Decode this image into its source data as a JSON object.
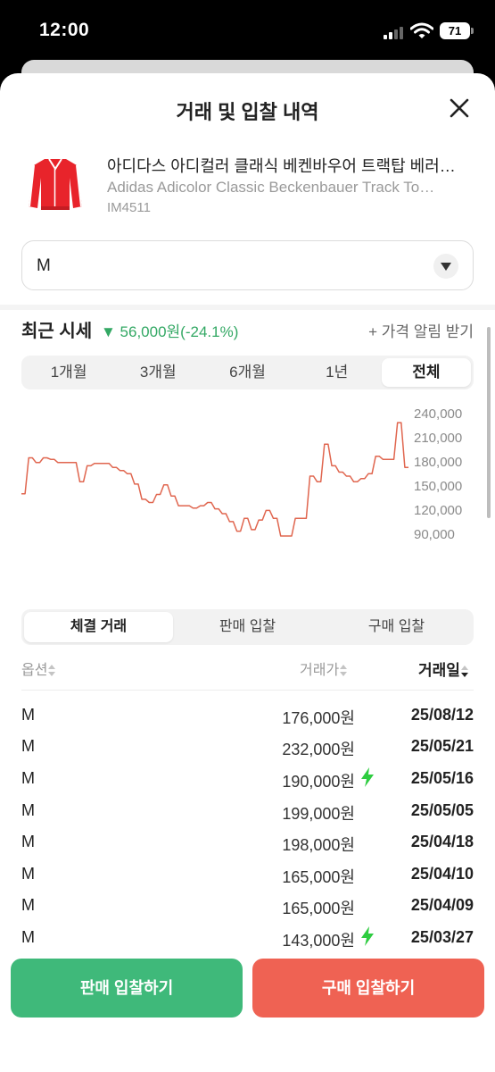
{
  "status_bar": {
    "time": "12:00",
    "battery": "71"
  },
  "sheet": {
    "title": "거래 및 입찰 내역"
  },
  "product": {
    "name_ko": "아디다스 아디컬러 클래식 베켄바우어 트랙탑 베러…",
    "name_en": "Adidas Adicolor Classic Beckenbauer Track To…",
    "code": "IM4511",
    "image": "red-track-jacket-icon"
  },
  "size_selector": {
    "value": "M"
  },
  "price_section": {
    "title": "최근 시세",
    "change": "▼ 56,000원(-24.1%)",
    "alert": "+ 가격 알림 받기"
  },
  "period_tabs": [
    {
      "label": "1개월",
      "active": false
    },
    {
      "label": "3개월",
      "active": false
    },
    {
      "label": "6개월",
      "active": false
    },
    {
      "label": "1년",
      "active": false
    },
    {
      "label": "전체",
      "active": true
    }
  ],
  "chart_data": {
    "type": "line",
    "line_color": "#e0664f",
    "y_ticks": [
      "240,000",
      "210,000",
      "180,000",
      "150,000",
      "120,000",
      "90,000"
    ],
    "ylim": [
      90000,
      240000
    ],
    "y": [
      143000,
      143000,
      188000,
      188000,
      182000,
      182000,
      188000,
      188000,
      186000,
      186000,
      182000,
      182000,
      182000,
      182000,
      182000,
      182000,
      158000,
      158000,
      178000,
      178000,
      181000,
      181000,
      181000,
      181000,
      181000,
      176000,
      176000,
      172000,
      172000,
      168000,
      168000,
      155000,
      155000,
      136000,
      136000,
      132000,
      132000,
      142000,
      142000,
      154000,
      154000,
      140000,
      140000,
      128000,
      128000,
      128000,
      128000,
      125000,
      125000,
      128000,
      128000,
      132000,
      132000,
      124000,
      124000,
      118000,
      118000,
      108000,
      108000,
      96000,
      96000,
      112000,
      112000,
      98000,
      98000,
      110000,
      110000,
      122000,
      122000,
      112000,
      112000,
      90000,
      90000,
      90000,
      90000,
      112000,
      112000,
      112000,
      112000,
      165000,
      165000,
      158000,
      158000,
      205000,
      205000,
      178000,
      178000,
      170000,
      170000,
      165000,
      165000,
      158000,
      158000,
      162000,
      162000,
      168000,
      168000,
      190000,
      190000,
      186000,
      186000,
      186000,
      186000,
      232000,
      232000,
      176000,
      176000
    ]
  },
  "tx_tabs": [
    {
      "label": "체결 거래",
      "active": true
    },
    {
      "label": "판매 입찰",
      "active": false
    },
    {
      "label": "구매 입찰",
      "active": false
    }
  ],
  "table": {
    "headers": {
      "option": "옵션",
      "price": "거래가",
      "date": "거래일"
    },
    "rows": [
      {
        "size": "M",
        "price": "176,000원",
        "bolt": false,
        "date": "25/08/12"
      },
      {
        "size": "M",
        "price": "232,000원",
        "bolt": false,
        "date": "25/05/21"
      },
      {
        "size": "M",
        "price": "190,000원",
        "bolt": true,
        "date": "25/05/16"
      },
      {
        "size": "M",
        "price": "199,000원",
        "bolt": false,
        "date": "25/05/05"
      },
      {
        "size": "M",
        "price": "198,000원",
        "bolt": false,
        "date": "25/04/18"
      },
      {
        "size": "M",
        "price": "165,000원",
        "bolt": false,
        "date": "25/04/10"
      },
      {
        "size": "M",
        "price": "165,000원",
        "bolt": false,
        "date": "25/04/09"
      },
      {
        "size": "M",
        "price": "143,000원",
        "bolt": true,
        "date": "25/03/27"
      }
    ]
  },
  "actions": {
    "sell": "판매 입찰하기",
    "buy": "구매 입찰하기"
  },
  "colors": {
    "positive": "#33a864",
    "sell": "#3fb97a",
    "buy": "#ef6253",
    "bolt": "#2ecc40"
  }
}
